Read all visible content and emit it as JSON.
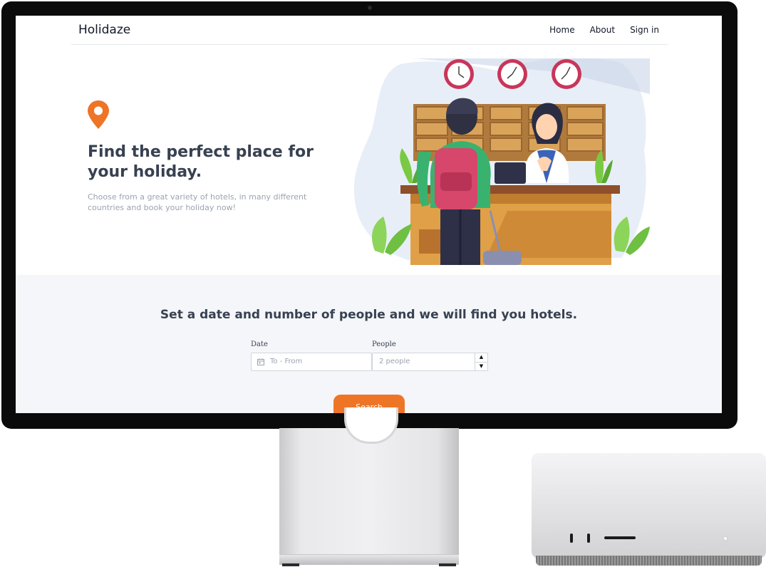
{
  "site": {
    "brand": "Holidaze",
    "nav": [
      "Home",
      "About",
      "Sign in"
    ]
  },
  "hero": {
    "title": "Find the perfect place for your holiday.",
    "subtitle": "Choose from a great variety of hotels, in many different countries and book your holiday now!",
    "pin_color": "#ee7526"
  },
  "search": {
    "title": "Set a date and number of people and we will find you hotels.",
    "date_label": "Date",
    "date_placeholder": "To - From",
    "people_label": "People",
    "people_placeholder": "2 people",
    "button_label": "Search",
    "accent": "#ee7526"
  },
  "icons": [
    "map-pin-icon",
    "calendar-icon",
    "spinner-up-icon",
    "spinner-down-icon"
  ]
}
